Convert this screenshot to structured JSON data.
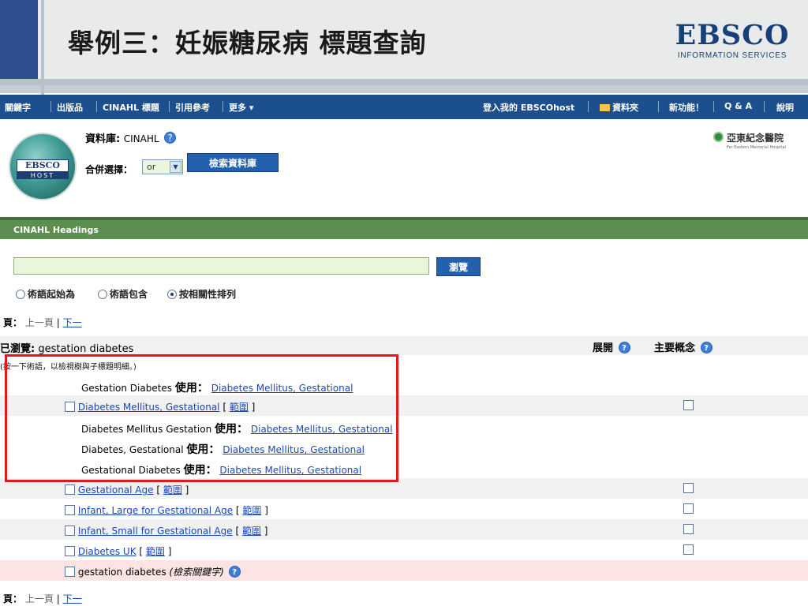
{
  "slide": {
    "title": "舉例三：妊娠糖尿病 標題查詢"
  },
  "brand": {
    "logo_word": "EBSCO",
    "logo_sub": "INFORMATION SERVICES",
    "host_word": "EBSCO",
    "host_sub": "HOST"
  },
  "nav": {
    "items": [
      "關鍵字",
      "出版品",
      "CINAHL 標題",
      "引用參考",
      "更多 ▾"
    ],
    "right_items": [
      "登入我的 EBSCOhost",
      "資料夾",
      "新功能！",
      "Q & A",
      "說明"
    ]
  },
  "database": {
    "label": "資料庫:",
    "name": "CINAHL",
    "combine_label": "合併選擇：",
    "combine_value": "or",
    "search_button": "檢索資料庫",
    "hospital_name": "亞東紀念醫院",
    "hospital_eng": "Far Eastern Memorial Hospital"
  },
  "headings": {
    "title": "CINAHL Headings"
  },
  "browse": {
    "input_value": "",
    "button_label": "瀏覽",
    "options": [
      "術語起始為",
      "術語包含",
      "按相關性排列"
    ],
    "selected_option": "按相關性排列"
  },
  "pager": {
    "label": "頁：",
    "prev": "上一頁",
    "sep": "|",
    "next": "下一"
  },
  "results": {
    "browsed_label": "已瀏覽:",
    "browsed_term": "gestation diabetes",
    "col_explode": "展開",
    "col_major": "主要概念",
    "hint": "(按一下術語，以檢視樹與子標題明細。)",
    "use_label": "使用：",
    "scope_label": "範圍",
    "rows": [
      {
        "type": "use",
        "term": "Gestation Diabetes",
        "target": "Diabetes Mellitus, Gestational"
      },
      {
        "type": "heading",
        "term": "Diabetes Mellitus, Gestational"
      },
      {
        "type": "use",
        "term": "Diabetes Mellitus Gestation",
        "target": "Diabetes Mellitus, Gestational"
      },
      {
        "type": "use",
        "term": "Diabetes, Gestational",
        "target": "Diabetes Mellitus, Gestational"
      },
      {
        "type": "use",
        "term": "Gestational Diabetes",
        "target": "Diabetes Mellitus, Gestational"
      },
      {
        "type": "heading",
        "term": "Gestational Age"
      },
      {
        "type": "heading",
        "term": "Infant, Large for Gestational Age"
      },
      {
        "type": "heading",
        "term": "Infant, Small for Gestational Age"
      },
      {
        "type": "heading",
        "term": "Diabetes UK"
      },
      {
        "type": "keyword",
        "term": "gestation diabetes",
        "note": "(檢索關鍵字)"
      }
    ]
  }
}
